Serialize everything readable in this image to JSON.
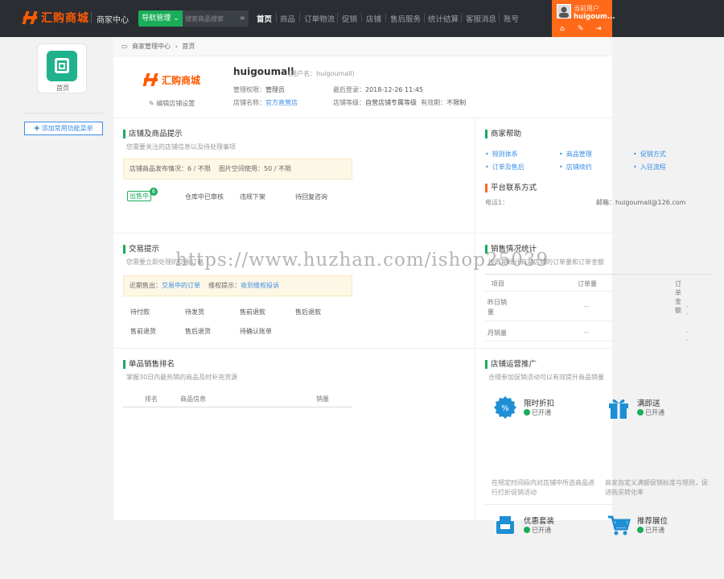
{
  "brand": {
    "name": "汇购商城",
    "accent": "#ff5a00",
    "green": "#1aad5a",
    "blue": "#3a8ee6"
  },
  "header": {
    "center_title": "商家中心",
    "nav_btn": "导航管理",
    "search_placeholder": "搜索商品搜索",
    "menus": [
      "首页",
      "商品",
      "订单物流",
      "促销",
      "店铺",
      "售后服务",
      "统计结算",
      "客服消息",
      "账号"
    ],
    "user_role": "当前用户",
    "user_name": "huigoum...",
    "user_icons": [
      "home-icon",
      "wrench-icon",
      "logout-icon"
    ]
  },
  "sidebar": {
    "home_label": "首页",
    "add_fav": "添加常用功能菜单"
  },
  "breadcrumb": {
    "root": "商家管理中心",
    "sep": "›",
    "current": "首页"
  },
  "store": {
    "logo_text": "汇购商城",
    "edit_label": "编辑店铺设置",
    "name": "huigoumall",
    "username": "(用户名：huigoumall)",
    "perm_label": "管理权限：",
    "perm_value": "管理员",
    "last_login_label": "最后登录：",
    "last_login_value": "2018-12-26 11:45",
    "shop_label": "店铺名称：",
    "shop_value": "官方直营店",
    "grade_label": "店铺等级：",
    "grade_value": "自营店铺专属等级",
    "valid_label": "有效期：",
    "valid_value": "不限制"
  },
  "tips": {
    "title": "店铺及商品提示",
    "subtitle": "您需要关注的店铺信息以及待处理事项",
    "notice_a": "店铺商品发布情况：6 / 不限",
    "notice_b": "图片空间使用：50 / 不限",
    "on_sale": "出售中",
    "on_sale_count": "6",
    "warehouse": "仓库中已审核",
    "violation": "违规下架",
    "pending_reply": "待回复咨询"
  },
  "help": {
    "title": "商家帮助",
    "links": [
      "规则体系",
      "商品管理",
      "促销方式",
      "订单及售后",
      "店铺续约",
      "入驻流程"
    ],
    "contact_title": "平台联系方式",
    "phone": "电话1：",
    "email": "邮箱：huigoumall@126.com"
  },
  "trade": {
    "title": "交易提示",
    "subtitle": "您需要立即处理的交易订单",
    "recent_label": "近期售出：",
    "recent_link": "交易中的订单",
    "rights_label": "维权提示：",
    "rights_link": "收到维权投诉",
    "items": [
      "待付款",
      "待发货",
      "售前退款",
      "售后退款",
      "售前退货",
      "售后退货",
      "待确认账单"
    ]
  },
  "sales": {
    "title": "销售情况统计",
    "subtitle": "按周期统计商家店铺的订单量和订单金额",
    "headers": [
      "项目",
      "订单量",
      "订单金额"
    ],
    "rows": [
      [
        "昨日销量",
        "--",
        "--"
      ],
      [
        "月销量",
        "--",
        "--"
      ]
    ]
  },
  "ranking": {
    "title": "单品销售排名",
    "subtitle": "掌握30日内最热销的商品及时补充货源",
    "headers": [
      "排名",
      "商品信息",
      "销量"
    ]
  },
  "promo": {
    "title": "店铺运营推广",
    "subtitle": "合理参加促销活动可以有效提升商品销量",
    "items": [
      {
        "name": "限时折扣",
        "status": "已开通",
        "desc": "在规定时间段内对店铺中所选商品进行打折促销活动",
        "icon": "discount-icon"
      },
      {
        "name": "满即送",
        "status": "已开通",
        "desc": "商家自定义满额促销标准与规则，促进购买转化率",
        "icon": "gift-icon"
      },
      {
        "name": "优惠套装",
        "status": "已开通",
        "desc": "",
        "icon": "bundle-icon"
      },
      {
        "name": "推荐展位",
        "status": "已开通",
        "desc": "",
        "icon": "cart-icon"
      }
    ]
  },
  "watermark": "https://www.huzhan.com/ishop25039"
}
